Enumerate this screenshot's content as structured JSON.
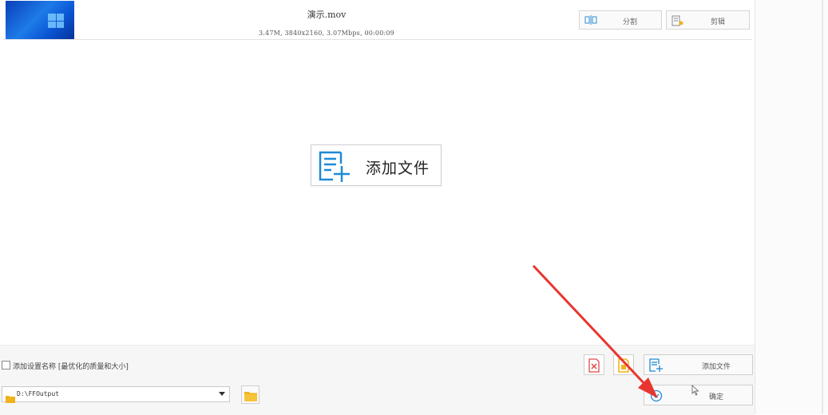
{
  "file_item": {
    "name": "演示.mov",
    "meta": "3.47M, 3840x2160, 3.07Mbps, 00:00:09",
    "split_label": "分割",
    "clip_label": "剪辑"
  },
  "center": {
    "add_file_label": "添加文件"
  },
  "bottom": {
    "checkbox_label": "添加设置名称 [最优化的质量和大小]",
    "output_path": "D:\\FFOutput",
    "add_file_label": "添加文件",
    "ok_label": "确定"
  },
  "colors": {
    "accent_blue": "#1f8ad6",
    "folder_yellow": "#f2b21c",
    "remove_red": "#e04a4a",
    "annotation_arrow": "#e8352f"
  },
  "icons": {
    "split": "split-icon",
    "clip": "clip-icon",
    "add_file": "add-file-icon",
    "folder": "folder-icon",
    "remove": "remove-file-icon",
    "clear": "clear-list-icon",
    "ok": "check-circle-icon"
  }
}
